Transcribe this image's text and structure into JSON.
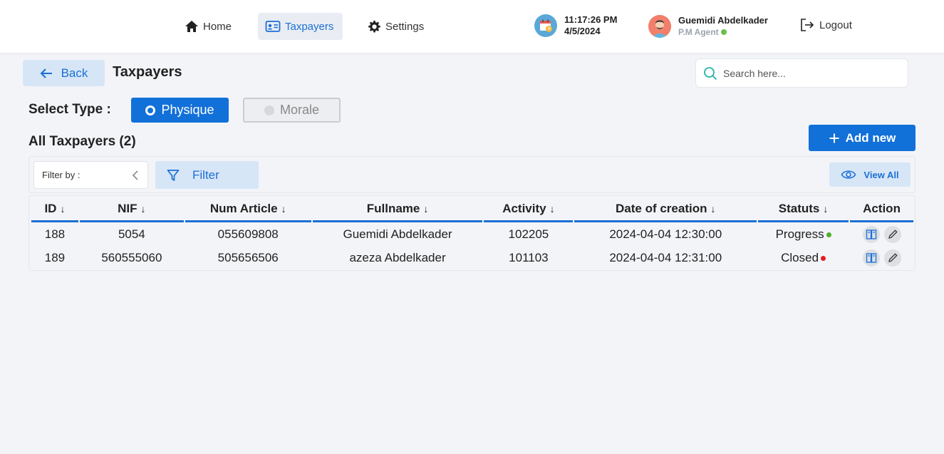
{
  "nav": {
    "home": "Home",
    "taxpayers": "Taxpayers",
    "settings": "Settings",
    "logout": "Logout"
  },
  "clock": {
    "time": "11:17:26 PM",
    "date": "4/5/2024"
  },
  "user": {
    "name": "Guemidi Abdelkader",
    "role": "P.M Agent",
    "status_color": "#6cbf4a"
  },
  "header": {
    "back_label": "Back",
    "title": "Taxpayers",
    "search_placeholder": "Search here..."
  },
  "type_select": {
    "label": "Select Type :",
    "options": [
      "Physique",
      "Morale"
    ],
    "selected": "Physique"
  },
  "list": {
    "title": "All Taxpayers (2)",
    "add_label": "Add new"
  },
  "filter": {
    "filter_by_label": "Filter by :",
    "filter_label": "Filter",
    "view_all_label": "View All"
  },
  "table": {
    "columns": [
      "ID",
      "NIF",
      "Num Article",
      "Fullname",
      "Activity",
      "Date of creation",
      "Statuts",
      "Action"
    ],
    "rows": [
      {
        "id": "188",
        "nif": "5054",
        "num_article": "055609808",
        "fullname": "Guemidi Abdelkader",
        "activity": "102205",
        "date": "2024-04-04 12:30:00",
        "status": "Progress",
        "status_color": "#4caf2a"
      },
      {
        "id": "189",
        "nif": "560555060",
        "num_article": "505656506",
        "fullname": "azeza Abdelkader",
        "activity": "101103",
        "date": "2024-04-04 12:31:00",
        "status": "Closed",
        "status_color": "#e81c1c"
      }
    ]
  },
  "colors": {
    "accent": "#1270d9",
    "accent_light": "#d6e6f7",
    "background": "#f3f4f8"
  }
}
